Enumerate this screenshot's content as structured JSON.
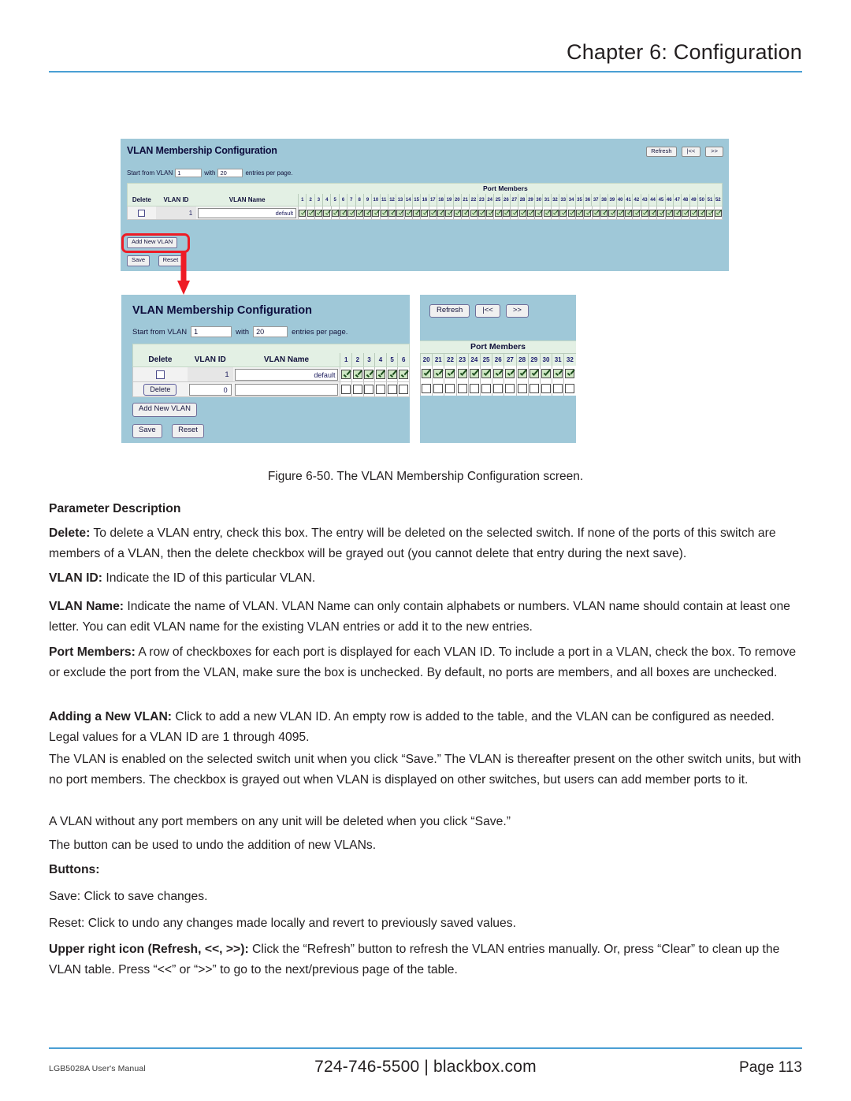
{
  "header": {
    "chapter_title": "Chapter 6: Configuration"
  },
  "footer": {
    "left": "LGB5028A User's Manual",
    "phone": "724-746-5500",
    "divider": "|",
    "site": "blackbox.com",
    "page": "Page 113"
  },
  "figure": {
    "caption": "Figure 6-50. The VLAN Membership Configuration screen.",
    "screen_a": {
      "title": "VLAN Membership Configuration",
      "toolbar": {
        "refresh": "Refresh",
        "prev": "|<<",
        "next": ">>"
      },
      "start_from_label": "Start from VLAN",
      "start_from_value": "1",
      "with_label": "with",
      "entries_value": "20",
      "entries_suffix": "entries per page.",
      "port_members_label": "Port Members",
      "columns": {
        "delete": "Delete",
        "vlan_id": "VLAN ID",
        "vlan_name": "VLAN Name"
      },
      "port_count": 52,
      "rows": [
        {
          "delete_checked": false,
          "vlan_id": "1",
          "vlan_name": "default",
          "all_ports_checked": true
        }
      ],
      "buttons": {
        "add_new_vlan": "Add New VLAN",
        "save": "Save",
        "reset": "Reset"
      }
    },
    "screen_b": {
      "title": "VLAN Membership Configuration",
      "toolbar": {
        "refresh": "Refresh",
        "prev": "|<<",
        "next": ">>"
      },
      "start_from_label": "Start from VLAN",
      "start_from_value": "1",
      "with_label": "with",
      "entries_value": "20",
      "entries_suffix": "entries per page.",
      "port_members_label": "Port Members",
      "columns": {
        "delete": "Delete",
        "vlan_id": "VLAN ID",
        "vlan_name": "VLAN Name"
      },
      "left_ports": [
        1,
        2,
        3,
        4,
        5,
        6
      ],
      "right_ports": [
        20,
        21,
        22,
        23,
        24,
        25,
        26,
        27,
        28,
        29,
        30,
        31,
        32
      ],
      "rows": [
        {
          "delete_control": "checkbox",
          "delete_checked": false,
          "vlan_id": "1",
          "vlan_name": "default",
          "ports_checked": true
        },
        {
          "delete_control": "button",
          "delete_label": "Delete",
          "vlan_id": "0",
          "vlan_name": "",
          "ports_checked": false
        }
      ],
      "buttons": {
        "add_new_vlan": "Add New VLAN",
        "save": "Save",
        "reset": "Reset"
      }
    },
    "callout_color": "#ee1c25"
  },
  "content": {
    "parameter_description_heading": "Parameter Description",
    "delete_lead": "Delete:",
    "delete_text": " To delete a VLAN entry, check this box. The entry will be deleted on the selected switch. If none of the ports of this switch are members of a VLAN, then the delete checkbox will be grayed out (you cannot delete that entry during the next save).",
    "vlanid_lead": "VLAN ID:",
    "vlanid_text": " Indicate the ID of this particular VLAN.",
    "vlanname_lead": "VLAN Name:",
    "vlanname_text": " Indicate the name of VLAN. VLAN Name can only contain alphabets or numbers. VLAN name should contain at least one letter. You can edit VLAN name for the existing VLAN entries or add it to the new entries.",
    "portmembers_lead": "Port Members:",
    "portmembers_text": " A row of checkboxes for each port is displayed for each VLAN ID. To include a port in a VLAN, check the box. To remove or exclude the port from the VLAN, make sure the box is unchecked. By default, no ports are members, and all boxes are unchecked.",
    "adding_lead": "Adding a New VLAN:",
    "adding_text": " Click to add a new VLAN ID. An empty row is added to the table, and the VLAN can be configured as needed. Legal values for a VLAN ID are 1 through 4095.",
    "para_enabled": "The VLAN is enabled on the selected switch unit when you click “Save.” The VLAN is thereafter present on the other switch units, but with no port members. The checkbox is grayed out when VLAN is displayed on other switches, but users can add member ports to it.",
    "para_without": "A VLAN without any port members on any unit will be deleted when you click “Save.”",
    "para_undo": "The button can be used to undo the addition of new VLANs.",
    "buttons_heading": "Buttons:",
    "save_text": "Save: Click to save changes.",
    "reset_text": "Reset: Click to undo any changes made locally and revert to previously saved values.",
    "upper_right_lead": "Upper right icon (Refresh, <<, >>):",
    "upper_right_text": " Click the “Refresh” button to refresh the VLAN entries manually. Or, press “Clear” to clean up the VLAN table. Press “<<” or “>>” to go to the next/previous page of the table."
  }
}
